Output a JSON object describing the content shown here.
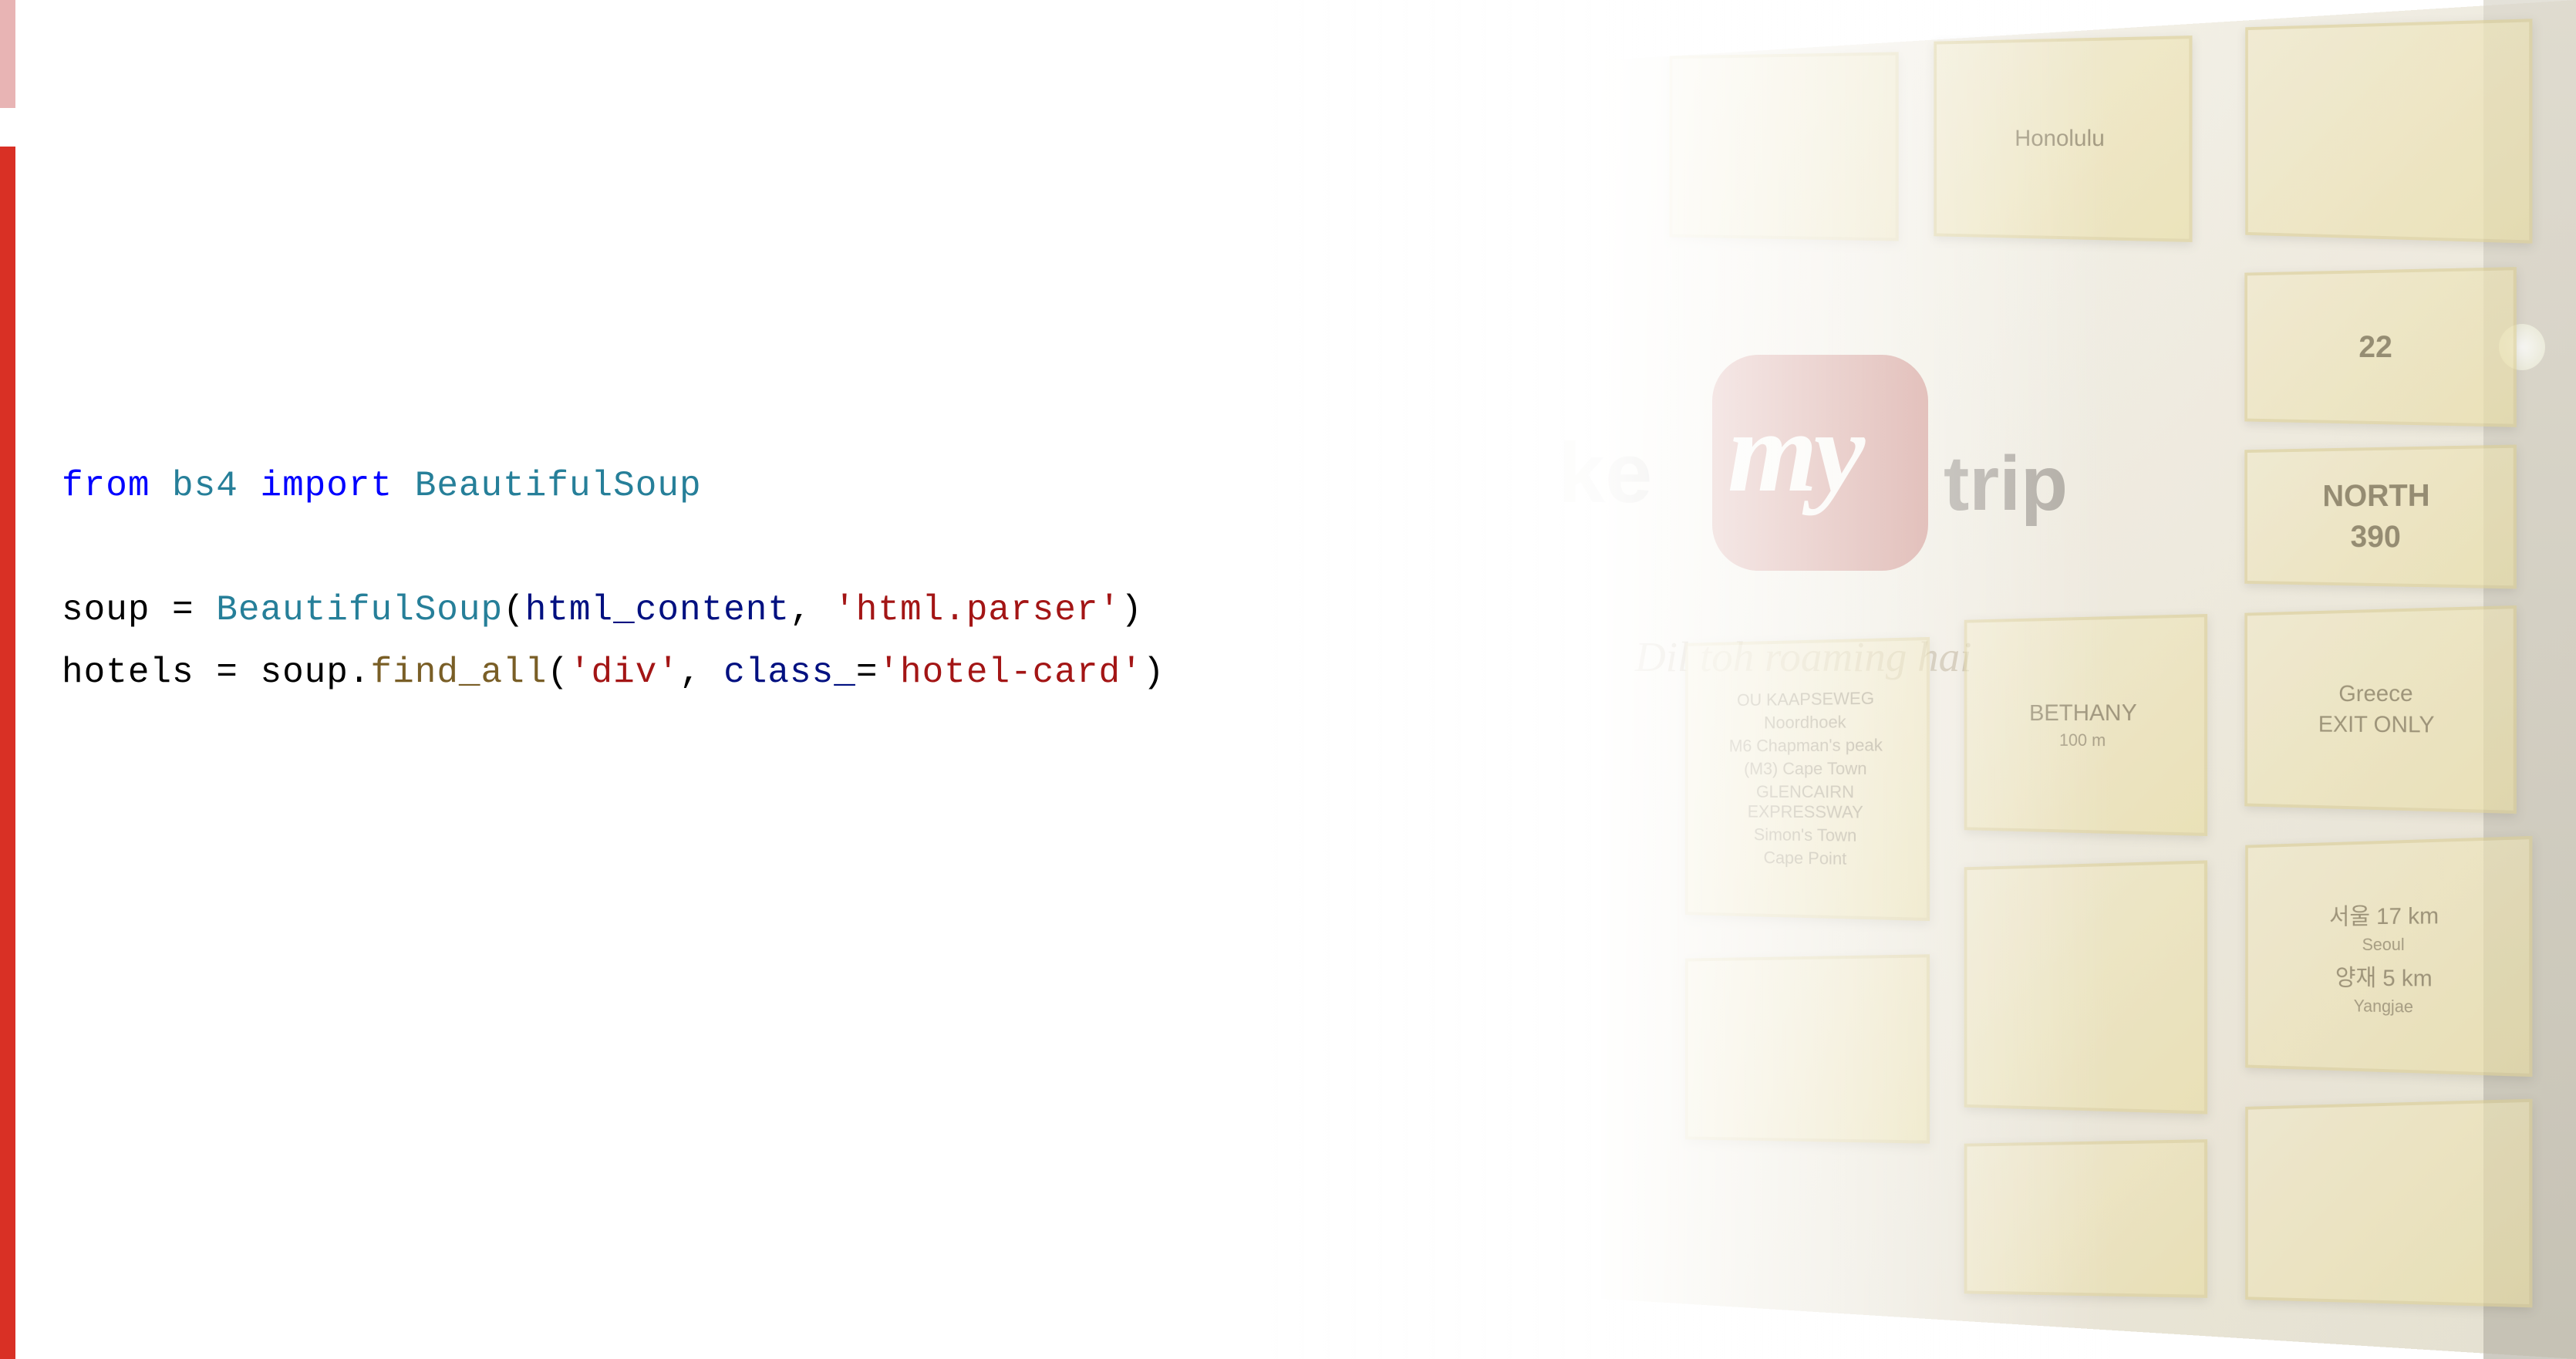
{
  "code": {
    "line1": {
      "kw_from": "from",
      "module": "bs4",
      "kw_import": "import",
      "cls": "BeautifulSoup"
    },
    "line3": {
      "var1": "soup",
      "op1": "=",
      "cls": "BeautifulSoup",
      "paren_open": "(",
      "arg1": "html_content",
      "comma1": ",",
      "str1": "'html.parser'",
      "paren_close": ")"
    },
    "line4": {
      "var1": "hotels",
      "op1": "=",
      "obj": "soup",
      "dot": ".",
      "method": "find_all",
      "paren_open": "(",
      "str1": "'div'",
      "comma1": ",",
      "kwarg": "class_",
      "op2": "=",
      "str2": "'hotel-card'",
      "paren_close": ")"
    }
  },
  "background": {
    "logo_prefix": "ke",
    "logo_script": "my",
    "logo_suffix": "trip",
    "tagline": "Dil toh roaming hai",
    "signs": {
      "north": "NORTH",
      "num_390": "390",
      "greece": "Greece",
      "exit_only": "EXIT ONLY",
      "num_22": "22",
      "ou_kaapseweg": "OU KAAPSEWEG",
      "noordhoek": "Noordhoek",
      "m6": "M6",
      "chapmans_peak": "Chapman's peak",
      "m3": "(M3)",
      "cape_town": "Cape Town",
      "glencairn": "GLENCAIRN EXPRESSWAY",
      "simons_town": "Simon's Town",
      "cape_point": "Cape Point",
      "bethany": "BETHANY",
      "dist_100m": "100 m",
      "seoul_kr": "서울",
      "dist_17km": "17 km",
      "seoul": "Seoul",
      "yangjae_kr": "양재",
      "dist_5km": "5 km",
      "yangjae": "Yangjae",
      "honolulu": "Honolulu"
    }
  }
}
